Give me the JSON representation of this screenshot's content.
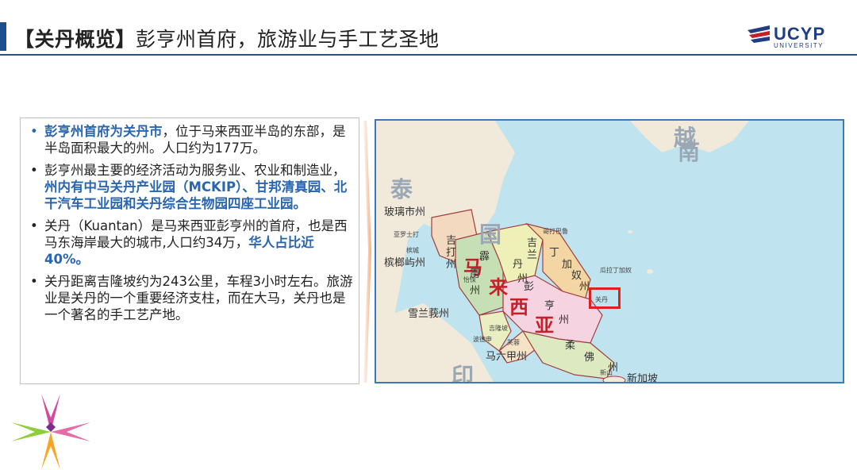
{
  "header": {
    "title_bold": "【关丹概览】",
    "title_rest": "彭亨州首府，旅游业与手工艺圣地"
  },
  "logo": {
    "name": "UCYP",
    "subtitle": "UNIVERSITY"
  },
  "bullets": [
    {
      "hl": "彭亨州首府为关丹市",
      "text": "，位于马来西亚半岛的东部，是半岛面积最大的州。人口约为177万。"
    },
    {
      "pre": "彭亨州最主要的经济活动为服务业、农业和制造业，",
      "hl": "州内有中马关丹产业园（MCKIP）、甘邦清真园、北干汽车工业园和关丹综合生物园四座工业园。"
    },
    {
      "pre": "关丹（Kuantan）是马来西亚彭亨州的首府，也是西马东海岸最大的城市,人口约34万，",
      "hl": "华人占比近40%。"
    },
    {
      "text": "关丹距离吉隆坡约为243公里，车程3小时左右。旅游业是关丹的一个重要经济支柱，而在大马，关丹也是一个著名的手工艺产地。"
    }
  ],
  "map": {
    "countries": {
      "vietnam_1": "越",
      "vietnam_2": "南",
      "thailand_1": "泰",
      "thailand_2": "国",
      "indonesia": "印"
    },
    "malaysia": {
      "ma": "马",
      "lai": "来",
      "xi": "西",
      "ya": "亚"
    },
    "states": {
      "perlis": "玻璃市州",
      "kedah_1": "吉",
      "kedah_2": "打",
      "kedah_3": "州",
      "penang": "槟榔屿州",
      "perak_1": "霹",
      "perak_2": "雳",
      "perak_3": "州",
      "kelantan_1": "吉",
      "kelantan_2": "兰",
      "kelantan_3": "丹",
      "kelantan_4": "州",
      "terengganu_1": "丁",
      "terengganu_2": "加",
      "terengganu_3": "奴",
      "terengganu_4": "州",
      "pahang_1": "彭",
      "pahang_2": "亨",
      "pahang_3": "州",
      "selangor": "雪兰莪州",
      "malacca": "马六甲州",
      "johor_1": "柔",
      "johor_2": "佛",
      "johor_3": "州",
      "singapore": "新加坡"
    },
    "cities": {
      "kuantan": "关丹",
      "kuala_terengganu": "瓜拉丁加奴",
      "alor_setar": "亚罗士打",
      "kota_bharu": "哥打巴鲁",
      "georgetown": "槟城",
      "ipoh": "怡保",
      "seremban": "芙蓉",
      "johor_bahru": "新山",
      "kl": "吉隆坡",
      "port_dickson": "波德申"
    }
  }
}
